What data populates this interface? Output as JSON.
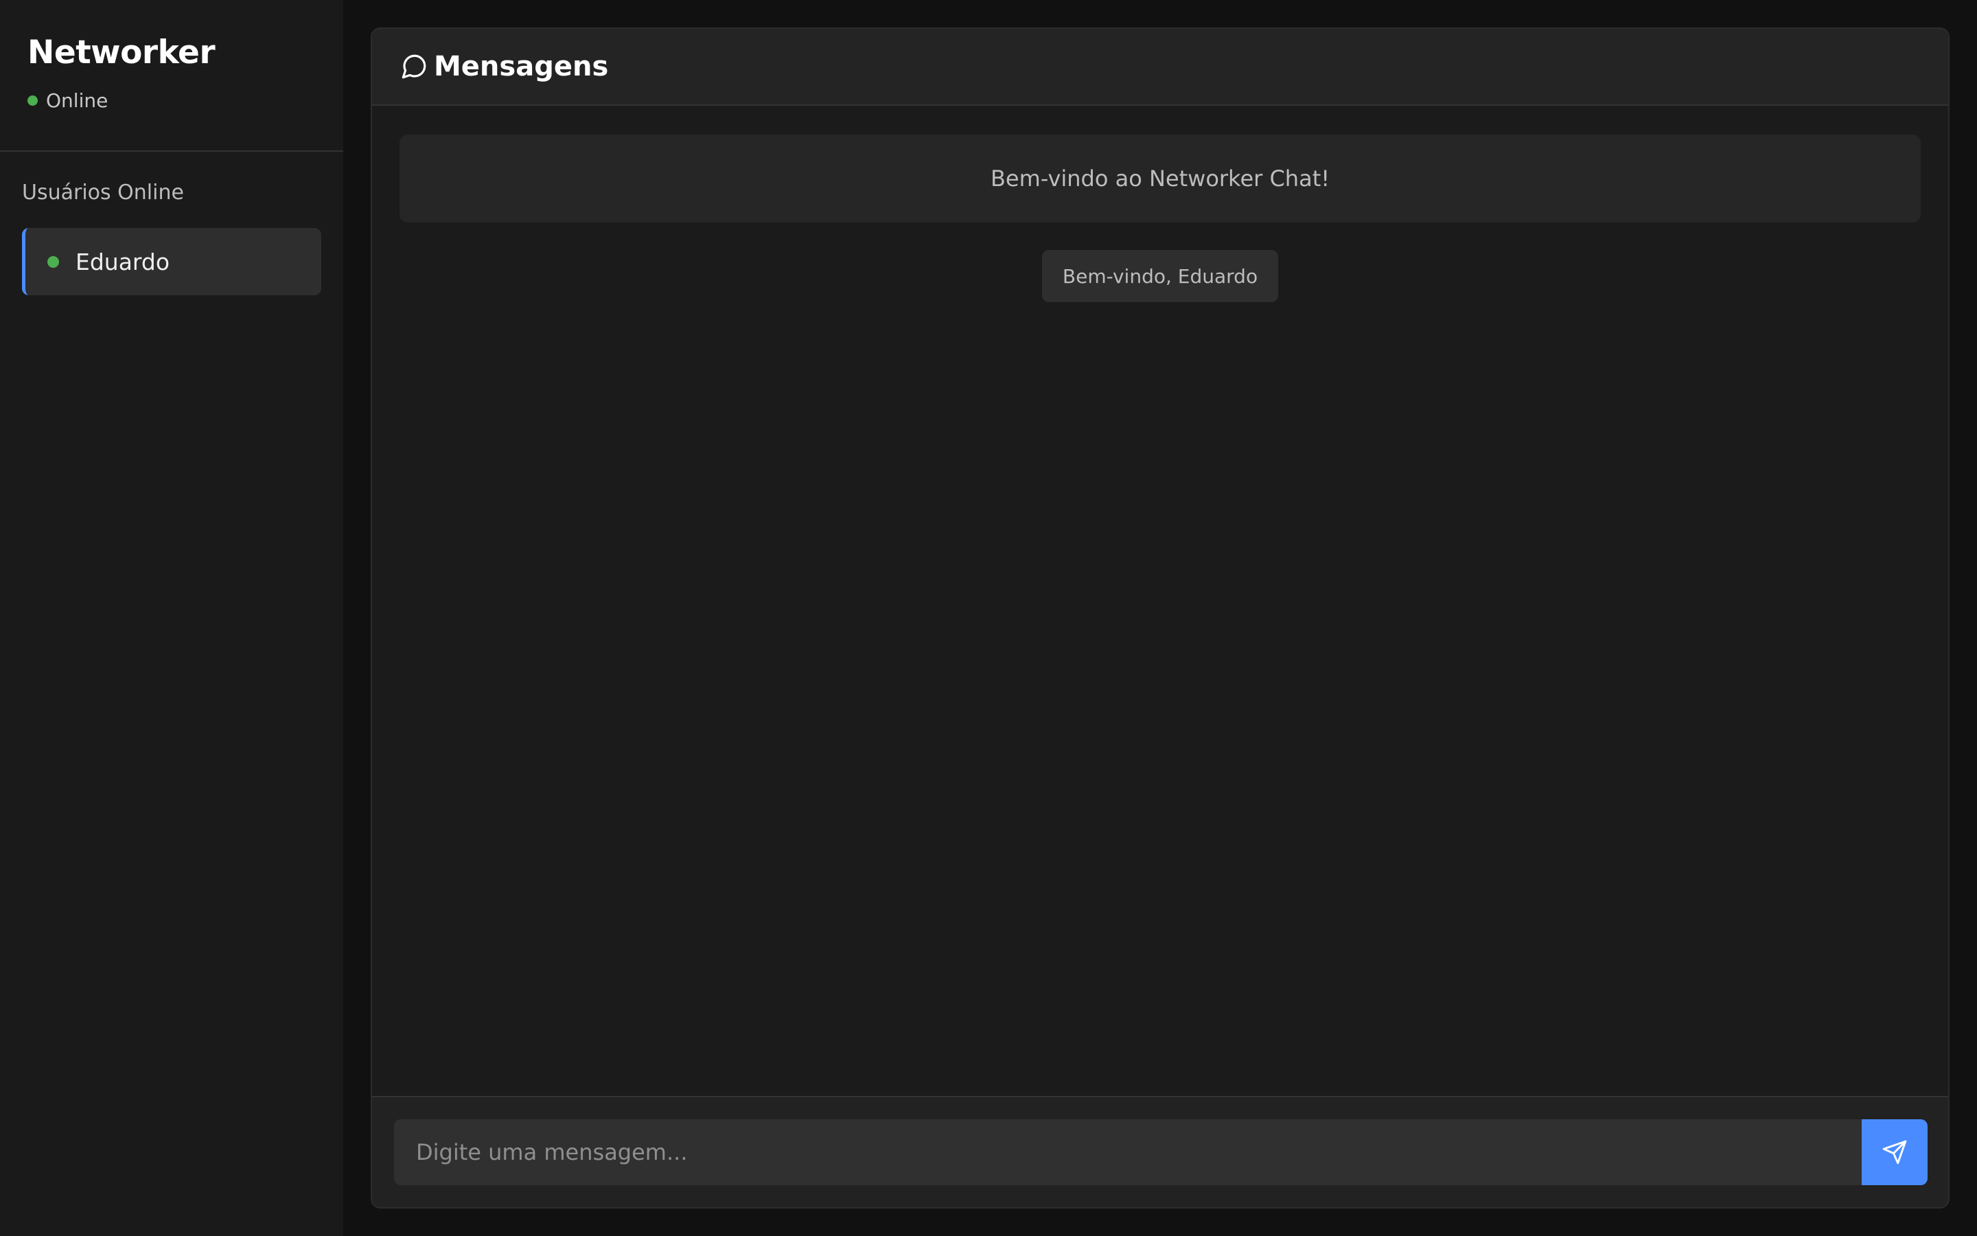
{
  "sidebar": {
    "brand": "Networker",
    "status": "Online",
    "section_title": "Usuários Online",
    "users": [
      {
        "name": "Eduardo"
      }
    ]
  },
  "chat": {
    "title": "Mensagens",
    "welcome": "Bem-vindo ao Networker Chat!",
    "system_message": "Bem-vindo, Eduardo",
    "input_placeholder": "Digite uma mensagem...",
    "icons": {
      "header": "chat-bubble-icon",
      "send": "paper-plane-icon"
    }
  },
  "colors": {
    "accent": "#4a8cff",
    "online": "#4caf50",
    "background": "#111111",
    "panel": "#1b1b1b"
  }
}
